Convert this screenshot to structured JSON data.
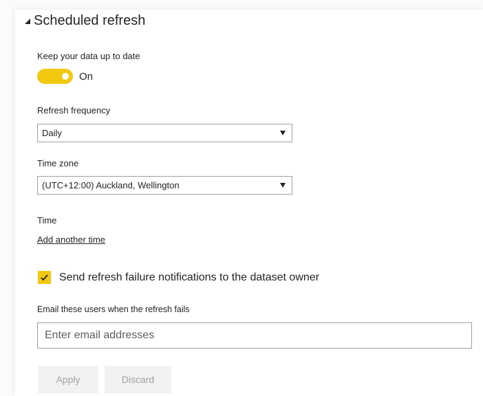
{
  "section": {
    "title": "Scheduled refresh",
    "collapse_icon": "triangle-collapse-icon"
  },
  "keep_up_to_date": {
    "label": "Keep your data up to date",
    "toggle_label": "On",
    "toggle_color": "#f2c811"
  },
  "refresh_frequency": {
    "label": "Refresh frequency",
    "value": "Daily"
  },
  "time_zone": {
    "label": "Time zone",
    "value": "(UTC+12:00) Auckland, Wellington"
  },
  "time": {
    "label": "Time",
    "add_link": "Add another time"
  },
  "notifications": {
    "checkbox_label": "Send refresh failure notifications to the dataset owner",
    "checked": true
  },
  "email": {
    "label": "Email these users when the refresh fails",
    "placeholder": "Enter email addresses",
    "value": ""
  },
  "actions": {
    "apply_label": "Apply",
    "discard_label": "Discard"
  },
  "colors": {
    "accent": "#f2c811",
    "text": "#252423",
    "disabled_text": "#a19f9d",
    "button_bg": "#f3f2f1"
  }
}
